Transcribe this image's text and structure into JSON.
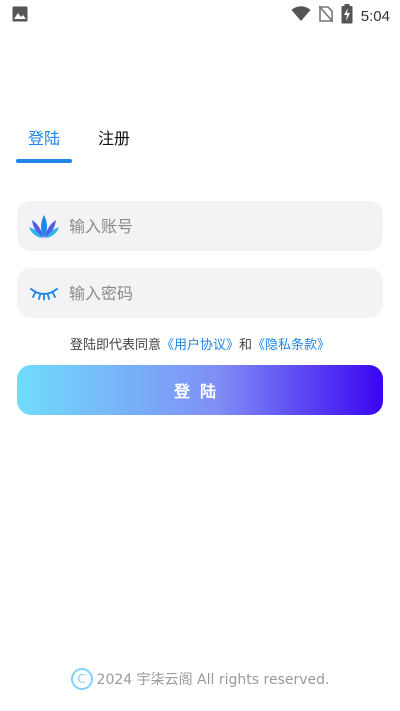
{
  "status_bar": {
    "time": "5:04",
    "left_icon": "image-icon",
    "icons": [
      "wifi-icon",
      "no-sim-icon",
      "battery-charging-icon"
    ]
  },
  "tabs": [
    {
      "label": "登陆",
      "active": true
    },
    {
      "label": "注册",
      "active": false
    }
  ],
  "account_field": {
    "placeholder": "输入账号",
    "value": "",
    "icon": "lotus-logo-icon"
  },
  "password_field": {
    "placeholder": "输入密码",
    "value": "",
    "icon": "eye-closed-icon"
  },
  "agreement": {
    "prefix": "登陆即代表同意",
    "user_agreement": "《用户协议》",
    "conjunction": "和",
    "privacy_terms": "《隐私条款》"
  },
  "login_button": {
    "label": "登陆"
  },
  "footer": {
    "copyright_symbol": "C",
    "text": "2024 宇柒云阁 All rights reserved."
  },
  "colors": {
    "accent": "#1e86e8",
    "button_gradient_start": "#70dcfb",
    "button_gradient_end": "#3a05f2"
  }
}
